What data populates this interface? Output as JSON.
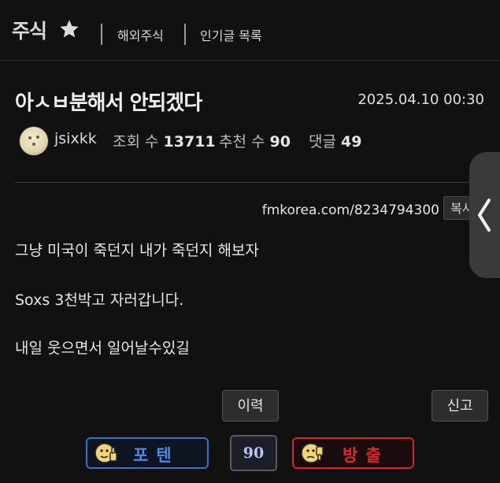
{
  "header": {
    "board_title": "주식",
    "nav": [
      "해외주식",
      "인기글 목록"
    ]
  },
  "post": {
    "title": "아ㅅㅂ분해서 안되겠다",
    "date": "2025.04.10 00:30",
    "author": "jsixkk",
    "stats": {
      "views_label": "조회 수",
      "views": "13711",
      "likes_label": "추천 수",
      "likes": "90",
      "comments_label": "댓글",
      "comments": "49"
    },
    "url": "fmkorea.com/8234794300",
    "copy_label": "복사",
    "body": [
      "그냥 미국이 죽던지 내가 죽던지 해보자",
      "Soxs 3천박고 자러갑니다.",
      "내일 웃으면서 일어날수있길"
    ]
  },
  "actions": {
    "history_label": "이력",
    "report_label": "신고"
  },
  "votes": {
    "up_label": "포텐",
    "count": "90",
    "down_label": "방출"
  },
  "colors": {
    "background": "#111111",
    "vote_up_border": "#3b6fc8",
    "vote_down_border": "#d2262e",
    "vote_down_text": "#e0262e"
  }
}
